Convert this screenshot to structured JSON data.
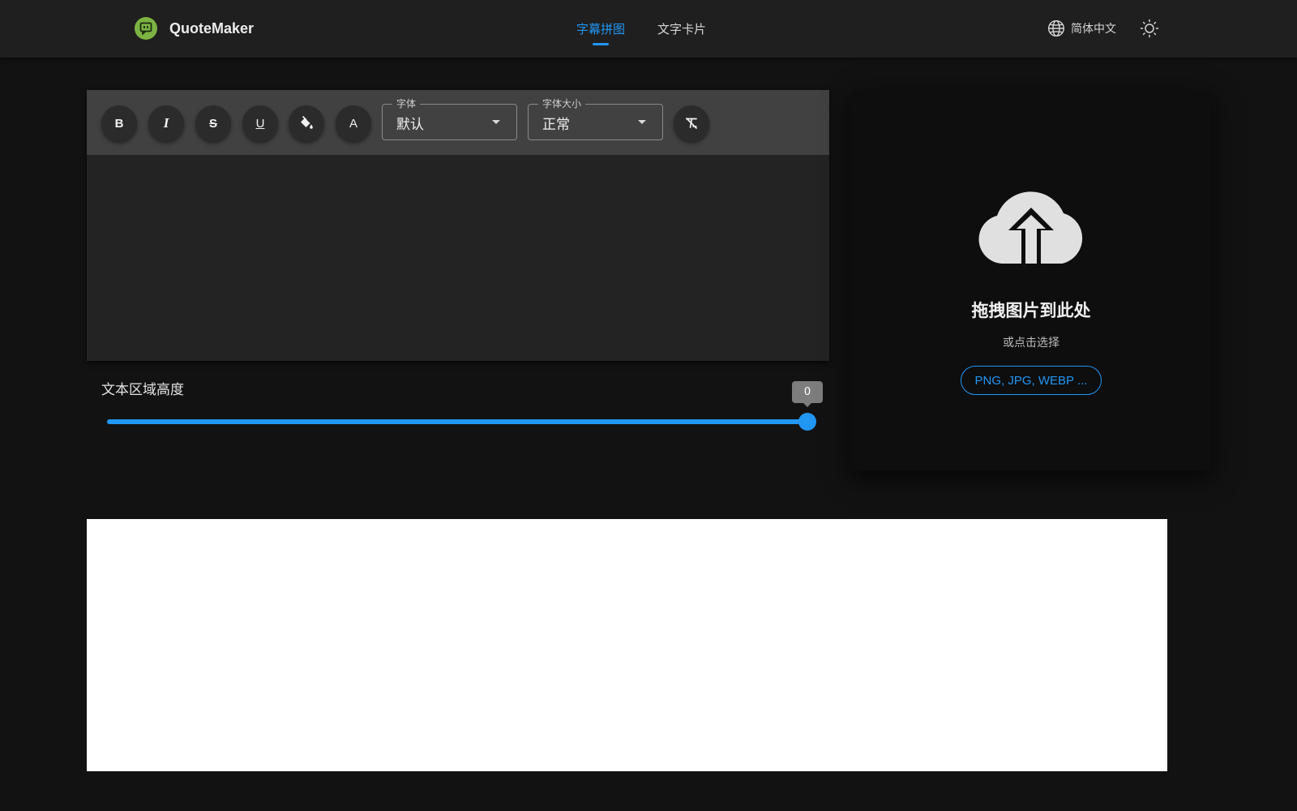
{
  "app": {
    "name": "QuoteMaker",
    "logo_icon": "quote-bubble-icon",
    "accent_color": "#2196f3",
    "logo_color": "#7cb342"
  },
  "nav": {
    "tabs": [
      {
        "label": "字幕拼图",
        "active": true
      },
      {
        "label": "文字卡片",
        "active": false
      }
    ]
  },
  "header": {
    "language_icon": "globe-icon",
    "language_label": "简体中文",
    "theme_icon": "sun-icon"
  },
  "toolbar": {
    "bold_label": "B",
    "italic_label": "I",
    "strike_label": "S",
    "underline_label": "U",
    "fill_icon": "paint-bucket-icon",
    "text_color_label": "A",
    "clear_format_icon": "clear-format-icon",
    "font": {
      "legend": "字体",
      "value": "默认"
    },
    "font_size": {
      "legend": "字体大小",
      "value": "正常"
    }
  },
  "slider": {
    "label": "文本区域高度",
    "value": "0",
    "position_fraction": 1.0
  },
  "upload": {
    "icon": "cloud-upload-icon",
    "title": "拖拽图片到此处",
    "subtitle": "或点击选择",
    "formats": "PNG, JPG, WEBP ..."
  }
}
